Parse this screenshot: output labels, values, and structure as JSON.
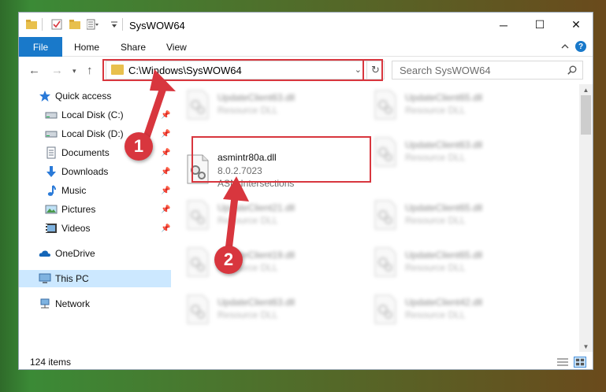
{
  "window": {
    "title": "SysWOW64",
    "minimize": "─",
    "maximize": "☐",
    "close": "✕"
  },
  "ribbon": {
    "tabs": [
      "File",
      "Home",
      "Share",
      "View"
    ],
    "help": "?"
  },
  "navigation": {
    "address": "C:\\Windows\\SysWOW64",
    "search_placeholder": "Search SysWOW64"
  },
  "sidebar": {
    "items": [
      {
        "label": "Quick access",
        "icon": "star-icon"
      },
      {
        "label": "Local Disk (C:)",
        "icon": "drive-icon",
        "pinned": true
      },
      {
        "label": "Local Disk (D:)",
        "icon": "drive-icon",
        "pinned": true
      },
      {
        "label": "Documents",
        "icon": "documents-icon",
        "pinned": true
      },
      {
        "label": "Downloads",
        "icon": "download-icon",
        "pinned": true
      },
      {
        "label": "Music",
        "icon": "music-icon",
        "pinned": true
      },
      {
        "label": "Pictures",
        "icon": "pictures-icon",
        "pinned": true
      },
      {
        "label": "Videos",
        "icon": "videos-icon",
        "pinned": true
      },
      {
        "label": "OneDrive",
        "icon": "cloud-icon"
      },
      {
        "label": "This PC",
        "icon": "computer-icon",
        "selected": true
      },
      {
        "label": "Network",
        "icon": "network-icon"
      }
    ]
  },
  "files": {
    "highlighted": {
      "name": "asmintr80a.dll",
      "version": "8.0.2.7023",
      "description": "ASM Intersections"
    },
    "blurred": [
      {
        "name": "UpdateClient63.dll",
        "type": "Resource DLL"
      },
      {
        "name": "UpdateClient65.dll",
        "type": "Resource DLL"
      },
      {
        "name": "UpdateClient63.dll",
        "type": "Resource DLL"
      },
      {
        "name": "UpdateClient21.dll",
        "type": "Resource DLL"
      },
      {
        "name": "UpdateClient65.dll",
        "type": "Resource DLL"
      },
      {
        "name": "UpdateClient19.dll",
        "type": "Resource DLL"
      },
      {
        "name": "UpdateClient65.dll",
        "type": "Resource DLL"
      },
      {
        "name": "UpdateClient63.dll",
        "type": "Resource DLL"
      },
      {
        "name": "UpdateClient42.dll",
        "type": "Resource DLL"
      }
    ]
  },
  "status": {
    "item_count": "124 items"
  },
  "annotations": {
    "step1": "1",
    "step2": "2",
    "color": "#d8363e"
  }
}
